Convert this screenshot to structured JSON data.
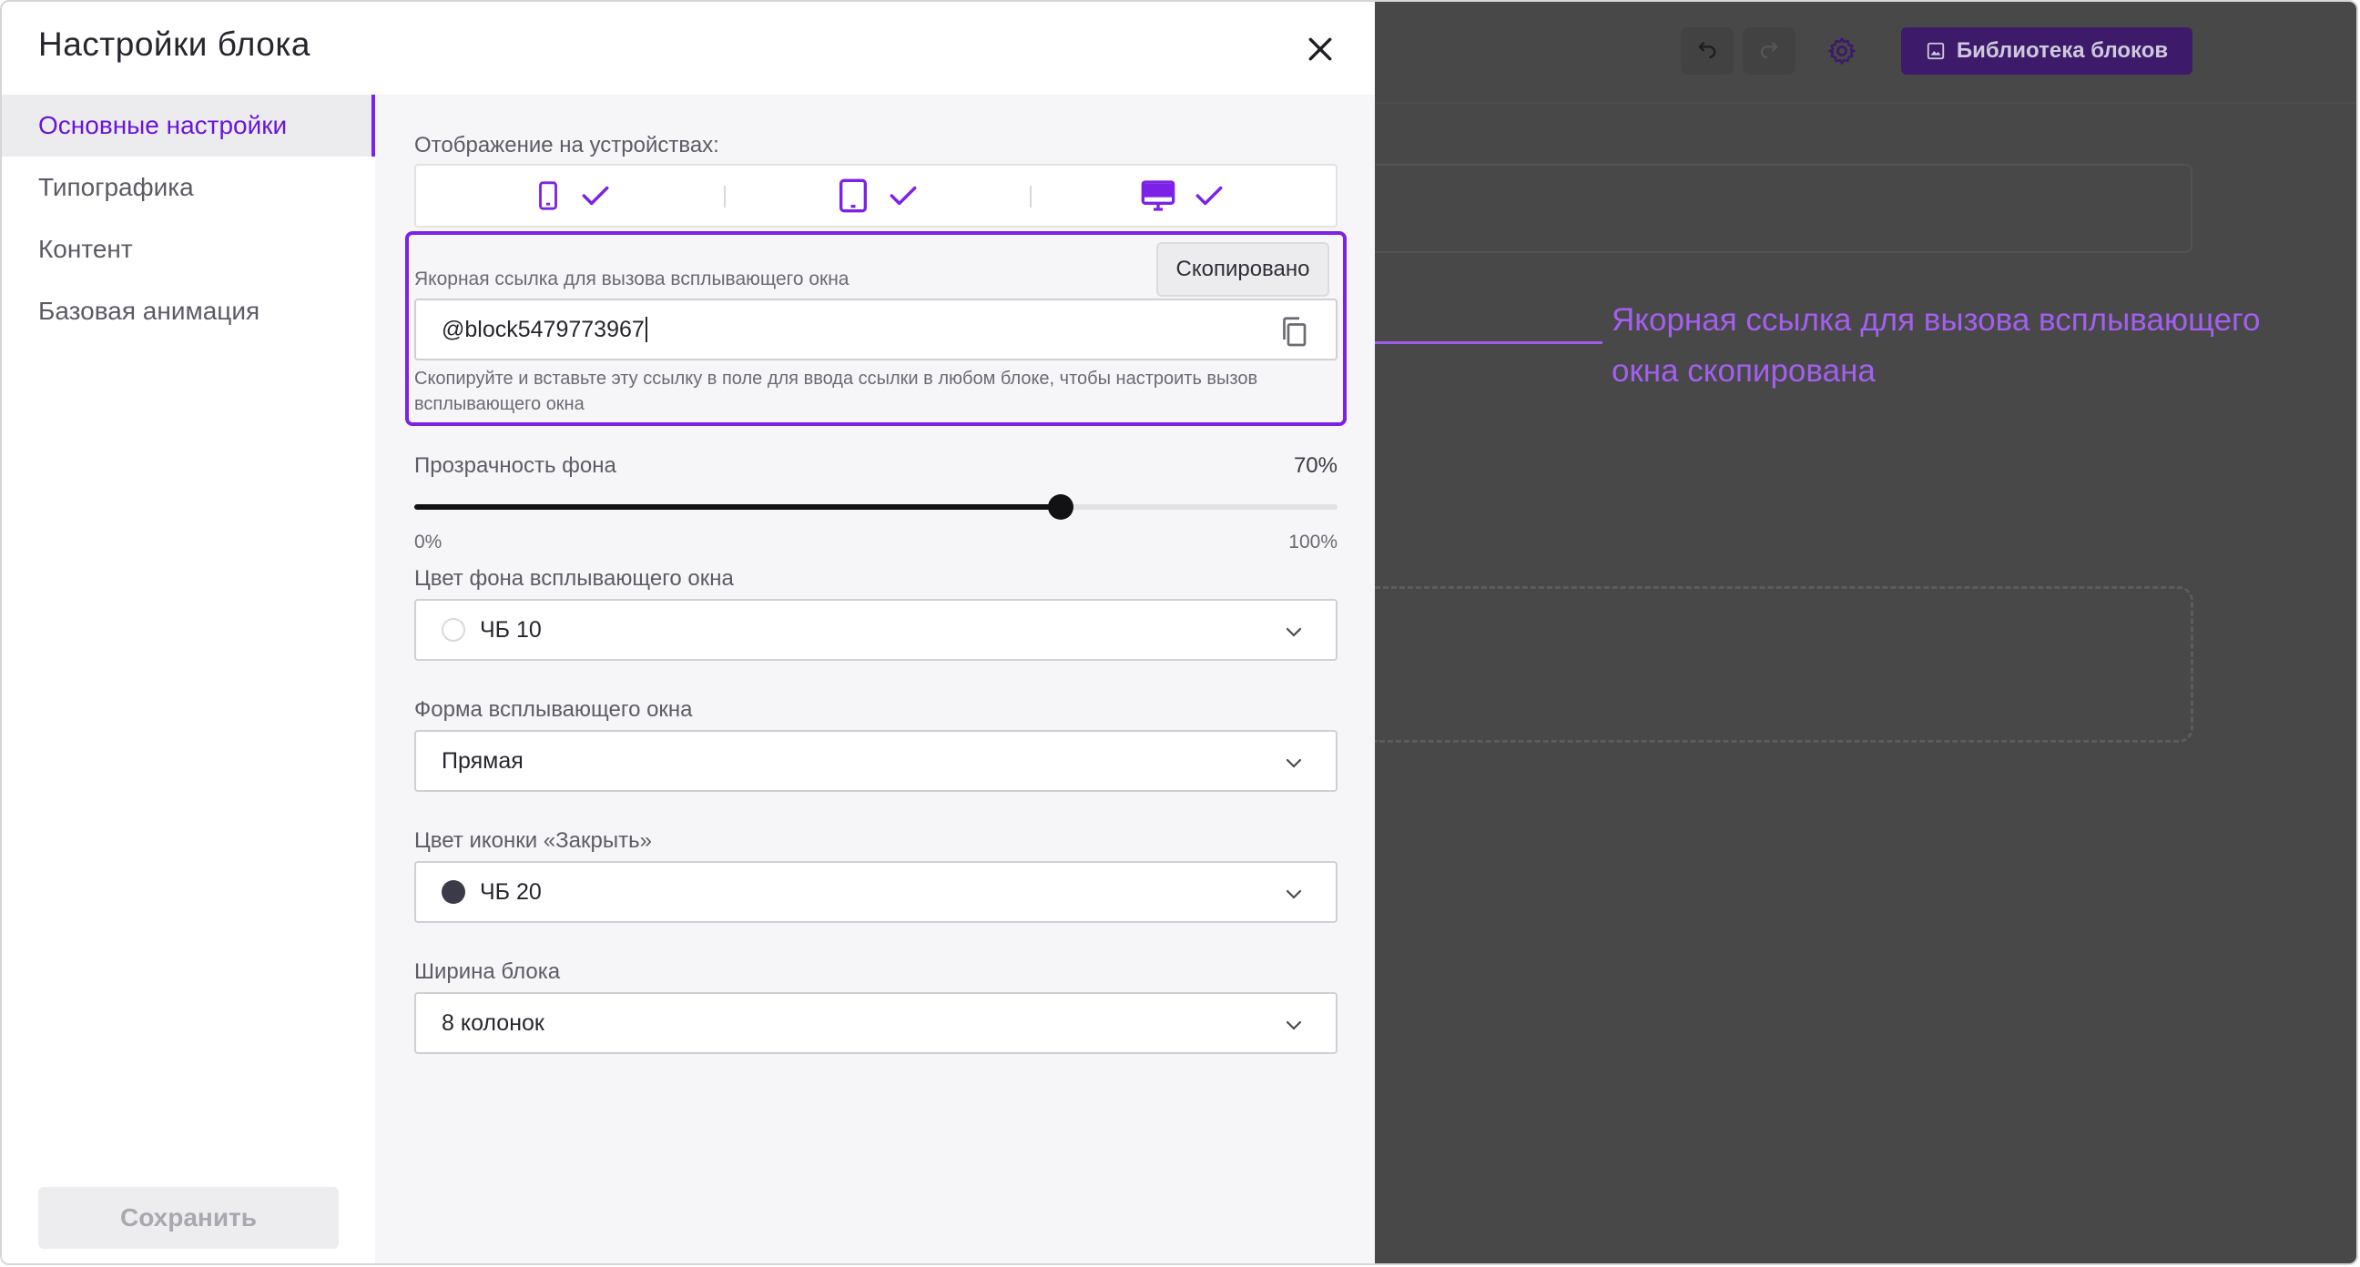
{
  "panel": {
    "title": "Настройки блока",
    "sidebar": {
      "items": [
        {
          "label": "Основные настройки",
          "active": true
        },
        {
          "label": "Типографика",
          "active": false
        },
        {
          "label": "Контент",
          "active": false
        },
        {
          "label": "Базовая анимация",
          "active": false
        }
      ],
      "save_label": "Сохранить"
    },
    "devices": {
      "label": "Отображение на устройствах:",
      "items": [
        {
          "icon": "mobile-icon",
          "checked": true
        },
        {
          "icon": "tablet-icon",
          "checked": true
        },
        {
          "icon": "desktop-icon",
          "checked": true
        }
      ]
    },
    "anchor": {
      "label": "Якорная ссылка для вызова всплывающего окна",
      "value": "@block5479773967",
      "tooltip": "Скопировано",
      "hint": "Скопируйте и вставьте эту ссылку в поле для ввода ссылки в любом блоке, чтобы настроить вызов всплывающего окна"
    },
    "opacity": {
      "label": "Прозрачность фона",
      "value_text": "70%",
      "value": 0.7,
      "min_label": "0%",
      "max_label": "100%"
    },
    "bg_color": {
      "label": "Цвет фона всплывающего окна",
      "value": "ЧБ 10",
      "swatch": "#ffffff"
    },
    "shape": {
      "label": "Форма всплывающего окна",
      "value": "Прямая"
    },
    "close_color": {
      "label": "Цвет иконки «Закрыть»",
      "value": "ЧБ 20",
      "swatch": "#3a3a48"
    },
    "width": {
      "label": "Ширина блока",
      "value": "8 колонок"
    }
  },
  "toolbar": {
    "library_label": "Библиотека блоков"
  },
  "callout": {
    "text": "Якорная ссылка для вызова всплывающего окна скопирована"
  },
  "colors": {
    "accent": "#7b22e6",
    "overlay": "#484848"
  }
}
